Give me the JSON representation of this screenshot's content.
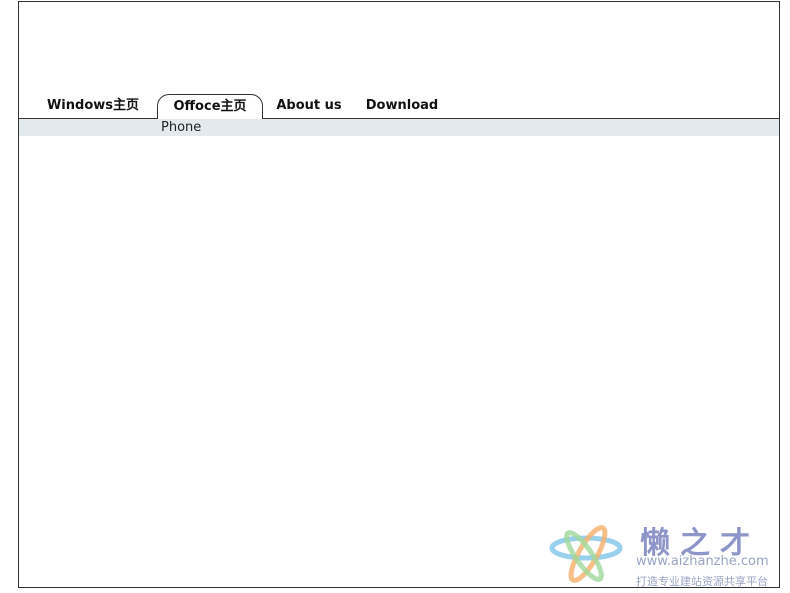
{
  "nav": {
    "tabs": [
      {
        "label": "Windows主页"
      },
      {
        "label": "Offoce主页",
        "active": true
      },
      {
        "label": "About us"
      },
      {
        "label": "Download"
      }
    ],
    "subnav": {
      "items": [
        {
          "label": "Phone"
        }
      ]
    }
  },
  "watermark": {
    "title": "懒之才",
    "url": "www.aizhanzhe.com",
    "slogan": "打造专业建站资源共享平台"
  },
  "colors": {
    "border": "#333333",
    "subnav_background": "#e2eaee",
    "watermark_text": "#8e95c9"
  }
}
